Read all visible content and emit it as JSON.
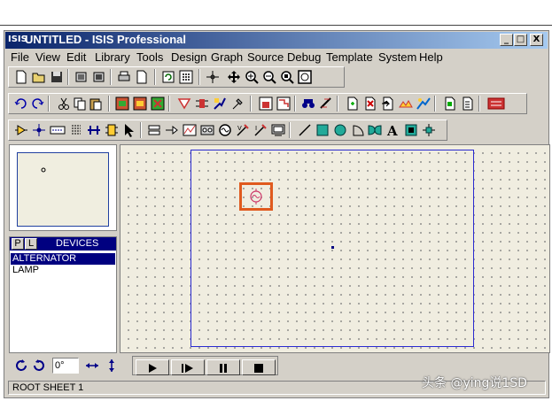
{
  "window": {
    "logo": "ISIS",
    "title": "UNTITLED - ISIS Professional",
    "minimize_glyph": "_",
    "maximize_glyph": "□",
    "close_glyph": "X"
  },
  "menu": [
    "File",
    "View",
    "Edit",
    "Library",
    "Tools",
    "Design",
    "Graph",
    "Source",
    "Debug",
    "Template",
    "System",
    "Help"
  ],
  "toolbar1_icons": [
    "new-icon",
    "open-icon",
    "save-icon",
    "import-icon",
    "export-icon",
    "print-icon",
    "set-area-icon",
    "redraw-icon",
    "grid-icon",
    "origin-icon",
    "pan-icon",
    "zoom-in-icon",
    "zoom-out-icon",
    "zoom-all-icon",
    "zoom-area-icon"
  ],
  "toolbar2_icons": [
    "undo-icon",
    "redo-icon",
    "cut-icon",
    "copy-icon",
    "paste-icon",
    "block-copy-icon",
    "block-move-icon",
    "block-rotate-icon",
    "block-delete-icon",
    "pick-device-icon",
    "make-device-icon",
    "package-tool-icon",
    "decompose-icon",
    "wire-autorouter-icon",
    "search-tag-icon",
    "property-tool-icon",
    "new-sheet-icon",
    "remove-sheet-icon",
    "goto-sheet-icon",
    "exit-parent-icon",
    "bom-icon",
    "erc-icon",
    "netlist-icon",
    "ares-icon"
  ],
  "toolbar3_icons": [
    "component-mode-icon",
    "junction-icon",
    "wire-label-icon",
    "text-script-icon",
    "bus-icon",
    "subcircuit-icon",
    "selection-icon",
    "terminal-icon",
    "pin-icon",
    "graph-icon",
    "tape-icon",
    "generator-icon",
    "voltage-probe-icon",
    "current-probe-icon",
    "virtual-instrument-icon",
    "line-icon",
    "box-icon",
    "circle-icon",
    "arc-icon",
    "path-icon",
    "text-icon",
    "symbol-icon",
    "marker-icon"
  ],
  "device_panel": {
    "p_label": "P",
    "l_label": "L",
    "title": "DEVICES",
    "items": [
      {
        "name": "ALTERNATOR",
        "selected": true
      },
      {
        "name": "LAMP",
        "selected": false
      }
    ]
  },
  "rotation": {
    "angle": "0°"
  },
  "playback": [
    "play-icon",
    "step-icon",
    "pause-icon",
    "stop-icon"
  ],
  "status": {
    "sheet": "ROOT SHEET 1"
  },
  "watermark": "头条 @ying说1SD",
  "colors": {
    "title_start": "#0a246a",
    "title_end": "#a6caf0",
    "selection": "#000080",
    "sheet_border": "#2a2ad0",
    "highlight": "#e05a1e"
  }
}
